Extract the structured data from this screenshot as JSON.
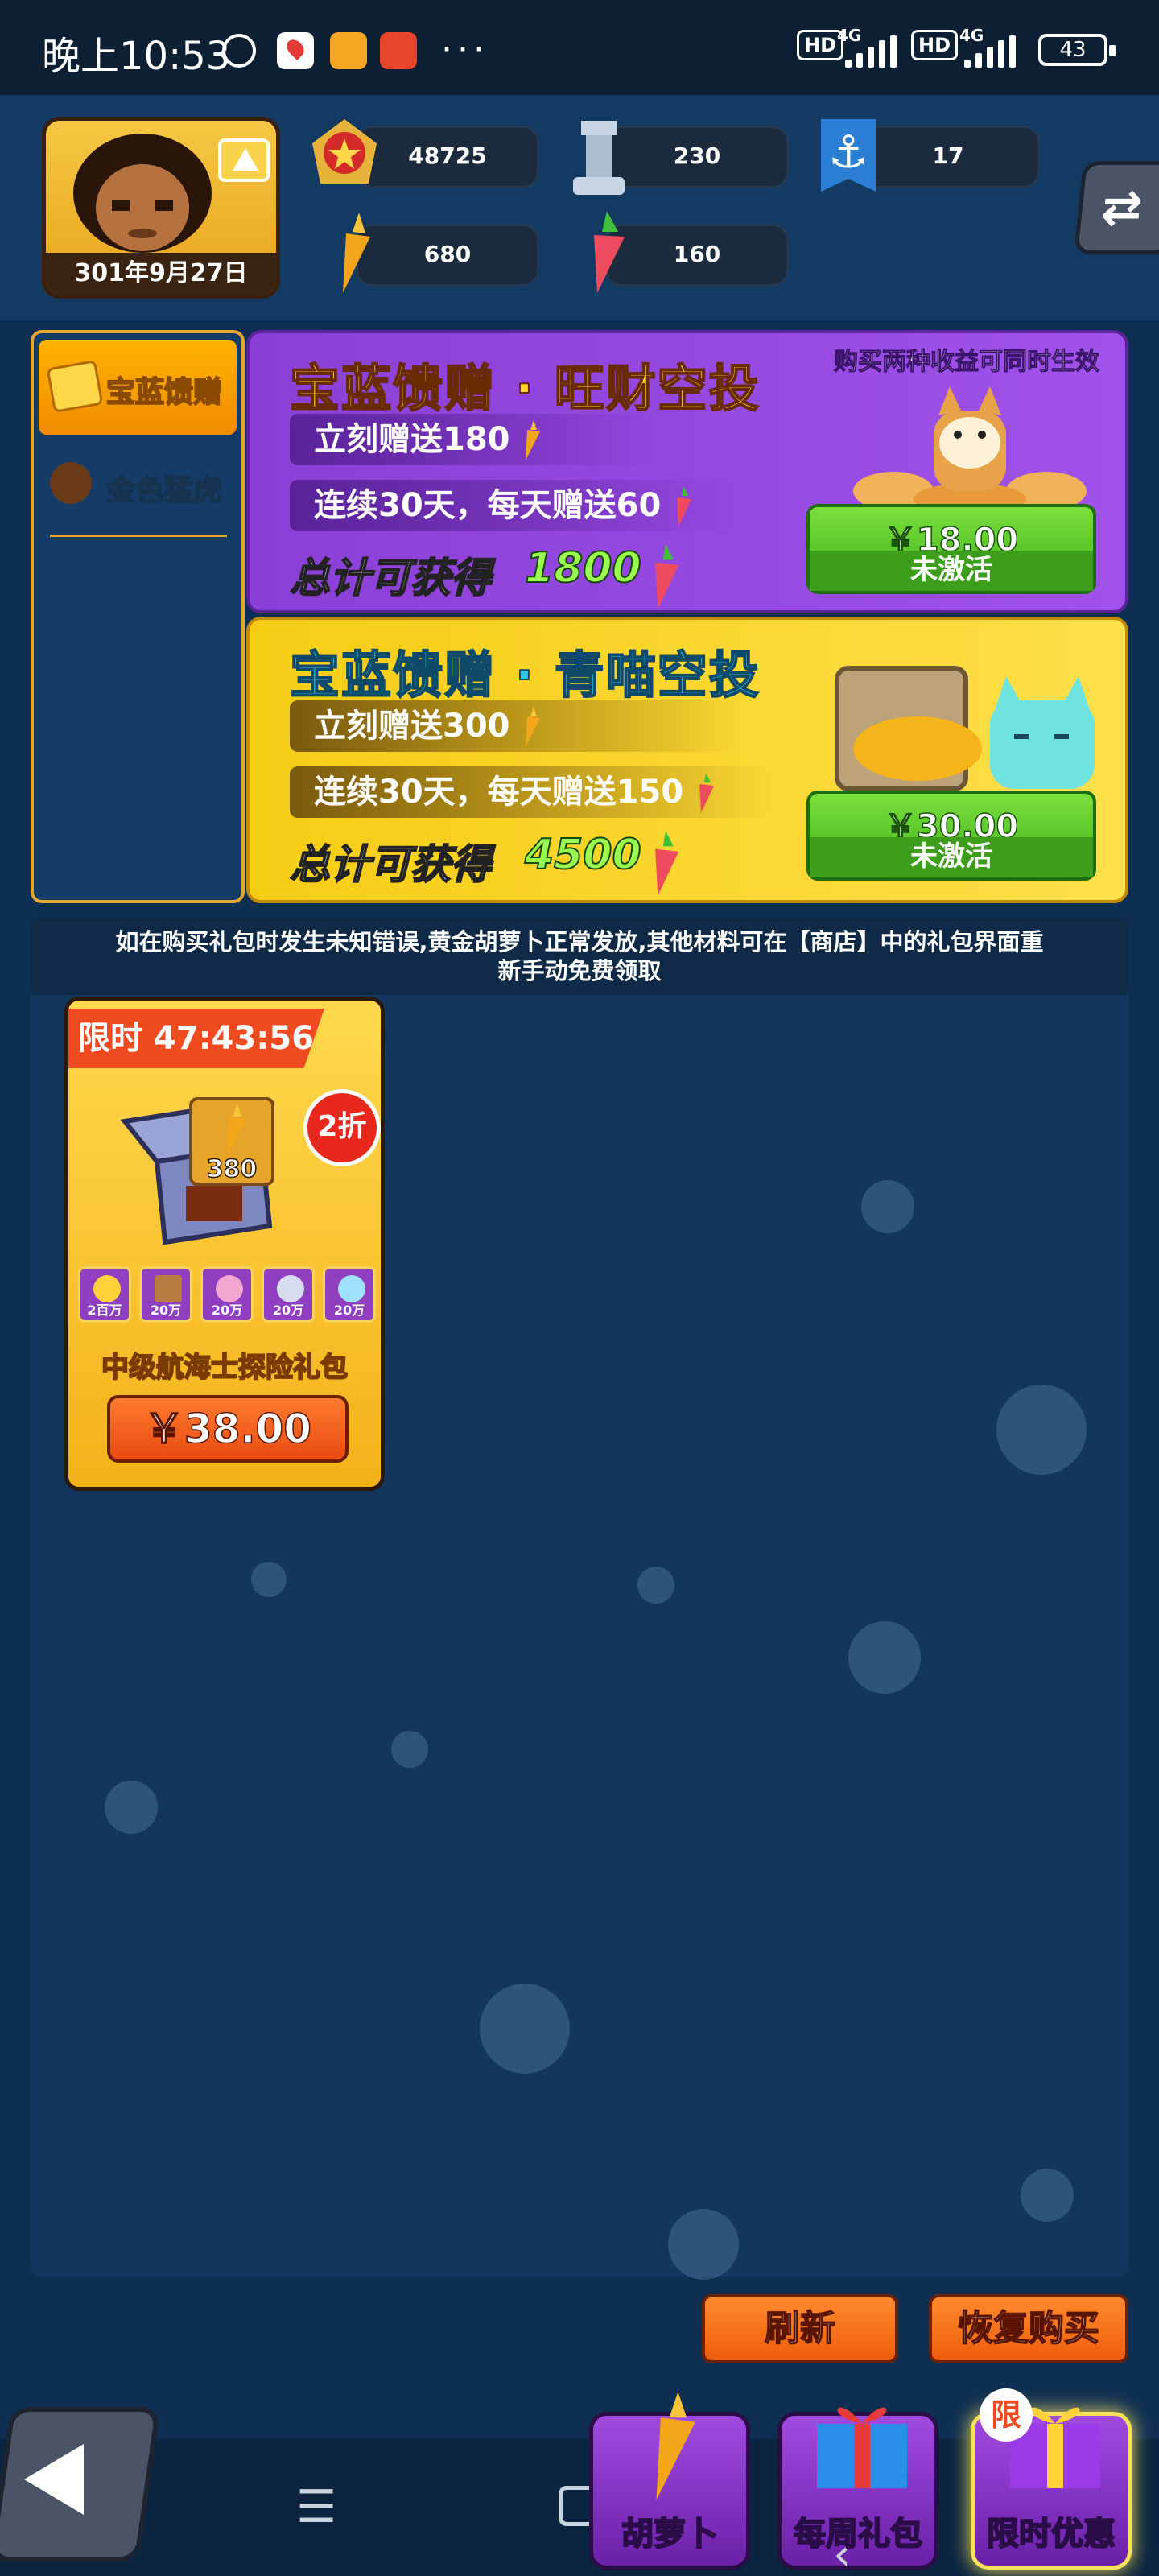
{
  "status_bar": {
    "time": "晚上10:53",
    "dots": "···",
    "net1": "4G",
    "net2": "4G",
    "hd": "HD",
    "battery": "43"
  },
  "header": {
    "date": "301年9月27日",
    "stats": [
      {
        "name": "medal",
        "value": "48725"
      },
      {
        "name": "tower",
        "value": "230"
      },
      {
        "name": "anchor",
        "value": "17"
      },
      {
        "name": "gold-carrot",
        "value": "680"
      },
      {
        "name": "red-carrot",
        "value": "160"
      }
    ]
  },
  "sidebar": {
    "items": [
      {
        "label": "宝蓝馈赠",
        "active": true
      },
      {
        "label": "金色猛虎",
        "active": false
      }
    ]
  },
  "offers": [
    {
      "title": "宝蓝馈赠 · 旺财空投",
      "note": "购买两种收益可同时生效",
      "line1": "立刻赠送180",
      "line2": "连续30天，每天赠送60",
      "total_label": "总计可获得",
      "total_value": "1800",
      "price": "￥18.00",
      "status": "未激活"
    },
    {
      "title": "宝蓝馈赠 · 青喵空投",
      "line1": "立刻赠送300",
      "line2": "连续30天，每天赠送150",
      "total_label": "总计可获得",
      "total_value": "4500",
      "price": "￥30.00",
      "status": "未激活"
    }
  ],
  "notice": "如在购买礼包时发生未知错误,黄金胡萝卜正常发放,其他材料可在【商店】中的礼包界面重新手动免费领取",
  "gift": {
    "timer": "限时 47:43:56",
    "discount": "2折",
    "count": "380",
    "materials": [
      "2百万",
      "20万",
      "20万",
      "20万",
      "20万"
    ],
    "name": "中级航海士探险礼包",
    "price": "￥38.00"
  },
  "buttons": {
    "refresh": "刷新",
    "restore": "恢复购买"
  },
  "tabs": [
    {
      "label": "胡萝卜"
    },
    {
      "label": "每周礼包"
    },
    {
      "label": "限时优惠",
      "badge": "限"
    }
  ],
  "colors": {
    "offer1_bg": "#9a4fe0",
    "offer2_bg": "#f7d21c",
    "accent_orange": "#f07a1e",
    "price_green": "#4cc020"
  }
}
